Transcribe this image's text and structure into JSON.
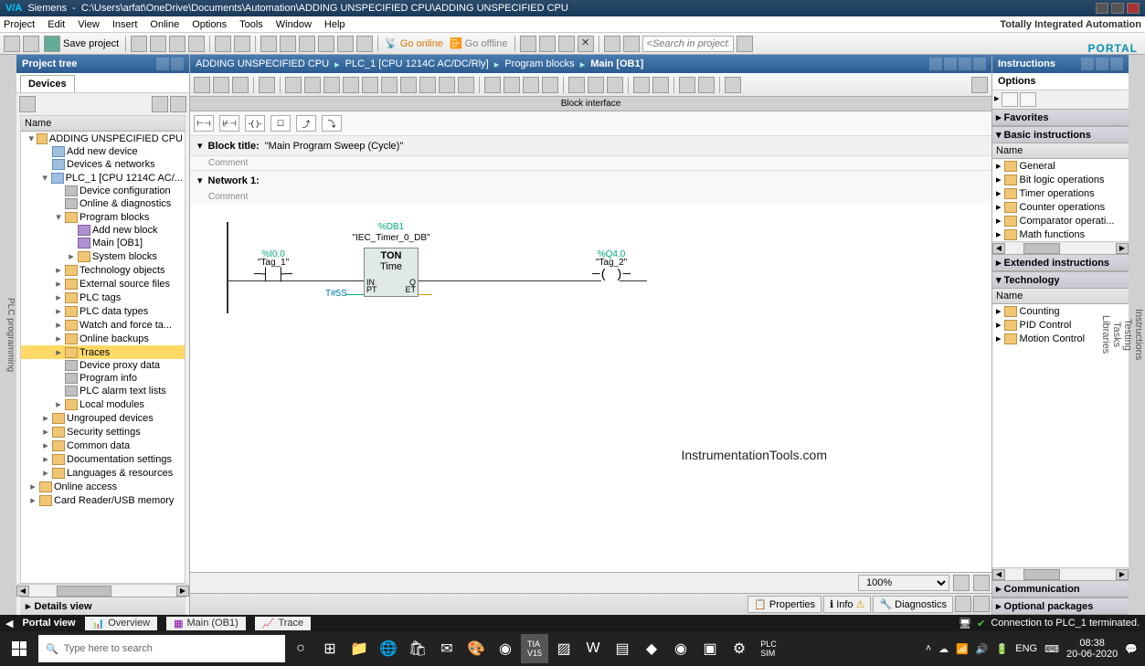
{
  "titlebar": {
    "app": "Siemens",
    "path": "C:\\Users\\arfat\\OneDrive\\Documents\\Automation\\ADDING UNSPECIFIED CPU\\ADDING UNSPECIFIED CPU"
  },
  "menu": {
    "items": [
      "Project",
      "Edit",
      "View",
      "Insert",
      "Online",
      "Options",
      "Tools",
      "Window",
      "Help"
    ],
    "branding": "Totally Integrated Automation",
    "portal": "PORTAL"
  },
  "toolbar": {
    "save": "Save project",
    "go_online": "Go online",
    "go_offline": "Go offline",
    "search_placeholder": "<Search in project>"
  },
  "project_tree": {
    "title": "Project tree",
    "tab": "Devices",
    "col": "Name",
    "items": [
      {
        "indent": 0,
        "toggle": "▾",
        "icon": "folder",
        "label": "ADDING UNSPECIFIED CPU"
      },
      {
        "indent": 1,
        "toggle": "",
        "icon": "device",
        "label": "Add new device"
      },
      {
        "indent": 1,
        "toggle": "",
        "icon": "device",
        "label": "Devices & networks"
      },
      {
        "indent": 1,
        "toggle": "▾",
        "icon": "device",
        "label": "PLC_1 [CPU 1214C AC/..."
      },
      {
        "indent": 2,
        "toggle": "",
        "icon": "config",
        "label": "Device configuration"
      },
      {
        "indent": 2,
        "toggle": "",
        "icon": "config",
        "label": "Online & diagnostics"
      },
      {
        "indent": 2,
        "toggle": "▾",
        "icon": "folder",
        "label": "Program blocks"
      },
      {
        "indent": 3,
        "toggle": "",
        "icon": "block",
        "label": "Add new block"
      },
      {
        "indent": 3,
        "toggle": "",
        "icon": "block",
        "label": "Main [OB1]"
      },
      {
        "indent": 3,
        "toggle": "▸",
        "icon": "folder",
        "label": "System blocks"
      },
      {
        "indent": 2,
        "toggle": "▸",
        "icon": "folder",
        "label": "Technology objects"
      },
      {
        "indent": 2,
        "toggle": "▸",
        "icon": "folder",
        "label": "External source files"
      },
      {
        "indent": 2,
        "toggle": "▸",
        "icon": "folder",
        "label": "PLC tags"
      },
      {
        "indent": 2,
        "toggle": "▸",
        "icon": "folder",
        "label": "PLC data types"
      },
      {
        "indent": 2,
        "toggle": "▸",
        "icon": "folder",
        "label": "Watch and force ta..."
      },
      {
        "indent": 2,
        "toggle": "▸",
        "icon": "folder",
        "label": "Online backups"
      },
      {
        "indent": 2,
        "toggle": "▸",
        "icon": "folder",
        "label": "Traces",
        "highlighted": true
      },
      {
        "indent": 2,
        "toggle": "",
        "icon": "config",
        "label": "Device proxy data"
      },
      {
        "indent": 2,
        "toggle": "",
        "icon": "config",
        "label": "Program info"
      },
      {
        "indent": 2,
        "toggle": "",
        "icon": "config",
        "label": "PLC alarm text lists"
      },
      {
        "indent": 2,
        "toggle": "▸",
        "icon": "folder",
        "label": "Local modules"
      },
      {
        "indent": 1,
        "toggle": "▸",
        "icon": "folder",
        "label": "Ungrouped devices"
      },
      {
        "indent": 1,
        "toggle": "▸",
        "icon": "folder",
        "label": "Security settings"
      },
      {
        "indent": 1,
        "toggle": "▸",
        "icon": "folder",
        "label": "Common data"
      },
      {
        "indent": 1,
        "toggle": "▸",
        "icon": "folder",
        "label": "Documentation settings"
      },
      {
        "indent": 1,
        "toggle": "▸",
        "icon": "folder",
        "label": "Languages & resources"
      },
      {
        "indent": 0,
        "toggle": "▸",
        "icon": "folder",
        "label": "Online access"
      },
      {
        "indent": 0,
        "toggle": "▸",
        "icon": "folder",
        "label": "Card Reader/USB memory"
      }
    ],
    "details": "Details view"
  },
  "side_tabs_left": "PLC programming",
  "breadcrumb": [
    "ADDING UNSPECIFIED CPU",
    "PLC_1 [CPU 1214C AC/DC/Rly]",
    "Program blocks",
    "Main [OB1]"
  ],
  "editor": {
    "block_iface": "Block interface",
    "block_title_label": "Block title:",
    "block_title_value": "\"Main Program Sweep (Cycle)\"",
    "comment": "Comment",
    "network_label": "Network 1:",
    "network_comment": "Comment",
    "db_addr": "%DB1",
    "db_name": "\"IEC_Timer_0_DB\"",
    "contact1_addr": "%I0.0",
    "contact1_name": "\"Tag_1\"",
    "timer_type": "TON",
    "timer_sub": "Time",
    "timer_in": "IN",
    "timer_q": "Q",
    "timer_pt": "PT",
    "timer_et": "ET",
    "pt_value": "T#5S",
    "coil_addr": "%Q4.0",
    "coil_name": "\"Tag_2\"",
    "zoom": "100%"
  },
  "bottom_tabs": {
    "properties": "Properties",
    "info": "Info",
    "diagnostics": "Diagnostics"
  },
  "instructions": {
    "title": "Instructions",
    "options": "Options",
    "favorites": "Favorites",
    "basic": "Basic instructions",
    "name_col": "Name",
    "basic_items": [
      "General",
      "Bit logic operations",
      "Timer operations",
      "Counter operations",
      "Comparator operati...",
      "Math functions"
    ],
    "extended": "Extended instructions",
    "technology": "Technology",
    "tech_items": [
      "Counting",
      "PID Control",
      "Motion Control"
    ],
    "communication": "Communication",
    "optional": "Optional packages"
  },
  "right_tabs": [
    "Instructions",
    "Testing",
    "Tasks",
    "Libraries"
  ],
  "status": {
    "portal": "Portal view",
    "overview": "Overview",
    "main": "Main (OB1)",
    "trace": "Trace",
    "connection": "Connection to PLC_1 terminated."
  },
  "taskbar": {
    "search": "Type here to search",
    "lang": "ENG",
    "time": "08:38",
    "date": "20-06-2020"
  },
  "watermark": "InstrumentationTools.com"
}
